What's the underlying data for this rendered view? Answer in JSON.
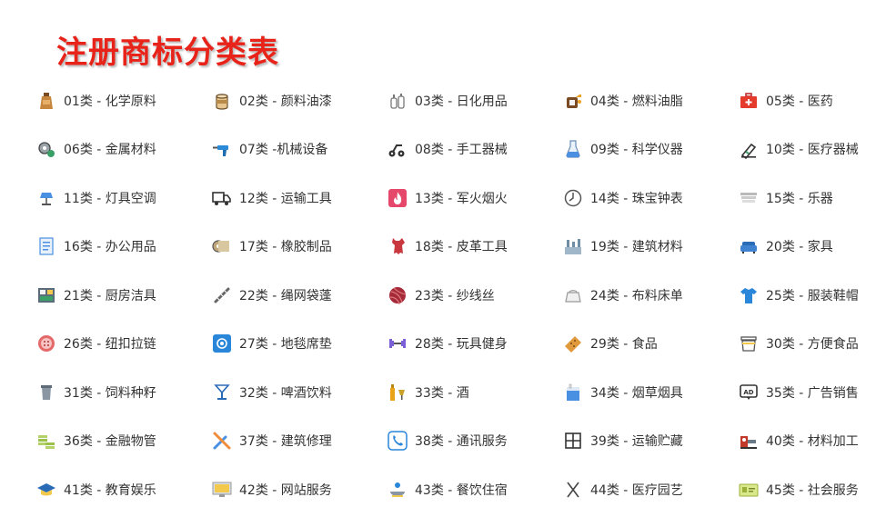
{
  "title": "注册商标分类表",
  "colors": {
    "title": "#e8231a",
    "text": "#333333"
  },
  "categories": [
    {
      "label": "01类 - 化学原料",
      "icon": "bottle-icon"
    },
    {
      "label": "02类 - 颜料油漆",
      "icon": "paint-can-icon"
    },
    {
      "label": "03类 - 日化用品",
      "icon": "cosmetics-icon"
    },
    {
      "label": "04类 - 燃料油脂",
      "icon": "fuel-can-icon"
    },
    {
      "label": "05类 - 医药",
      "icon": "first-aid-kit-icon"
    },
    {
      "label": "06类 - 金属材料",
      "icon": "metal-gear-icon"
    },
    {
      "label": "07类 -机械设备",
      "icon": "drill-icon"
    },
    {
      "label": "08类 - 手工器械",
      "icon": "tool-cart-icon"
    },
    {
      "label": "09类 - 科学仪器",
      "icon": "flask-icon"
    },
    {
      "label": "10类 - 医疗器械",
      "icon": "medical-device-icon"
    },
    {
      "label": "11类 - 灯具空调",
      "icon": "lamp-icon"
    },
    {
      "label": "12类 - 运输工具",
      "icon": "truck-icon"
    },
    {
      "label": "13类 - 军火烟火",
      "icon": "fire-icon"
    },
    {
      "label": "14类 - 珠宝钟表",
      "icon": "clock-icon"
    },
    {
      "label": "15类 - 乐器",
      "icon": "instrument-icon"
    },
    {
      "label": "16类 - 办公用品",
      "icon": "document-icon"
    },
    {
      "label": "17类 - 橡胶制品",
      "icon": "rubber-roll-icon"
    },
    {
      "label": "18类 - 皮革工具",
      "icon": "leather-icon"
    },
    {
      "label": "19类 - 建筑材料",
      "icon": "building-icon"
    },
    {
      "label": "20类 - 家具",
      "icon": "sofa-icon"
    },
    {
      "label": "21类 - 厨房洁具",
      "icon": "kitchen-icon"
    },
    {
      "label": "22类 - 绳网袋蓬",
      "icon": "rope-icon"
    },
    {
      "label": "23类 - 纱线丝",
      "icon": "yarn-icon"
    },
    {
      "label": "24类 - 布料床单",
      "icon": "fabric-icon"
    },
    {
      "label": "25类 - 服装鞋帽",
      "icon": "shirt-icon"
    },
    {
      "label": "26类 - 纽扣拉链",
      "icon": "button-icon"
    },
    {
      "label": "27类 - 地毯席垫",
      "icon": "carpet-icon"
    },
    {
      "label": "28类 - 玩具健身",
      "icon": "dumbbell-icon"
    },
    {
      "label": "29类 - 食品",
      "icon": "cracker-icon"
    },
    {
      "label": "30类 - 方便食品",
      "icon": "noodle-box-icon"
    },
    {
      "label": "31类 - 饲料种籽",
      "icon": "feed-bucket-icon"
    },
    {
      "label": "32类 - 啤酒饮料",
      "icon": "cocktail-icon"
    },
    {
      "label": "33类 - 酒",
      "icon": "wine-bottle-icon"
    },
    {
      "label": "34类 - 烟草烟具",
      "icon": "cigarette-pack-icon"
    },
    {
      "label": "35类 - 广告销售",
      "icon": "ad-board-icon"
    },
    {
      "label": "36类 - 金融物管",
      "icon": "coins-icon"
    },
    {
      "label": "37类 - 建筑修理",
      "icon": "wrench-icon"
    },
    {
      "label": "38类 - 通讯服务",
      "icon": "phone-icon"
    },
    {
      "label": "39类 - 运输贮藏",
      "icon": "storage-grid-icon"
    },
    {
      "label": "40类 - 材料加工",
      "icon": "machine-icon"
    },
    {
      "label": "41类 - 教育娱乐",
      "icon": "graduation-cap-icon"
    },
    {
      "label": "42类 - 网站服务",
      "icon": "monitor-icon"
    },
    {
      "label": "43类 - 餐饮住宿",
      "icon": "dining-icon"
    },
    {
      "label": "44类 - 医疗园艺",
      "icon": "scissors-icon"
    },
    {
      "label": "45类 - 社会服务",
      "icon": "id-card-icon"
    }
  ]
}
